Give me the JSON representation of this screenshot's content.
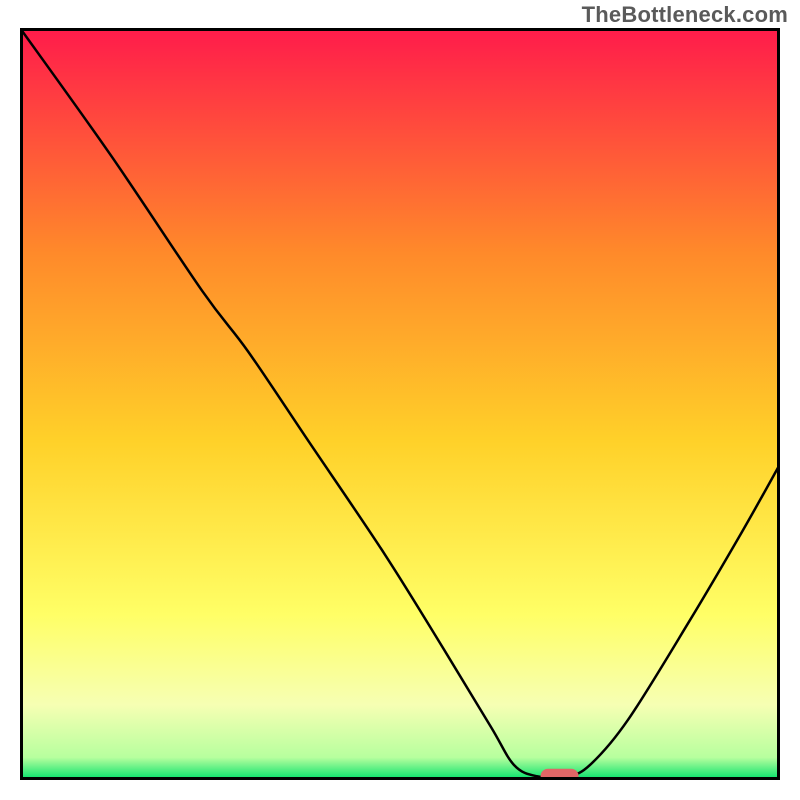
{
  "watermark": "TheBottleneck.com",
  "chart_data": {
    "type": "line",
    "title": "",
    "xlabel": "",
    "ylabel": "",
    "xlim": [
      0,
      100
    ],
    "ylim": [
      0,
      100
    ],
    "grid": false,
    "legend": false,
    "background_gradient": {
      "top_color": "#ff1b4b",
      "mid_colors": [
        "#ff8a2a",
        "#ffd129",
        "#ffff66",
        "#f6ffb3"
      ],
      "bottom_color": "#00e06a"
    },
    "series": [
      {
        "name": "bottleneck-curve",
        "stroke": "#000000",
        "stroke_width": 2.5,
        "points": [
          {
            "x": 0.0,
            "y": 100.0
          },
          {
            "x": 12.0,
            "y": 83.0
          },
          {
            "x": 24.0,
            "y": 65.0
          },
          {
            "x": 30.0,
            "y": 57.0
          },
          {
            "x": 38.0,
            "y": 45.0
          },
          {
            "x": 48.0,
            "y": 30.0
          },
          {
            "x": 56.0,
            "y": 17.0
          },
          {
            "x": 62.0,
            "y": 7.0
          },
          {
            "x": 65.0,
            "y": 2.0
          },
          {
            "x": 68.0,
            "y": 0.5
          },
          {
            "x": 72.0,
            "y": 0.5
          },
          {
            "x": 75.0,
            "y": 2.0
          },
          {
            "x": 80.0,
            "y": 8.0
          },
          {
            "x": 88.0,
            "y": 21.0
          },
          {
            "x": 95.0,
            "y": 33.0
          },
          {
            "x": 100.0,
            "y": 42.0
          }
        ]
      }
    ],
    "marker": {
      "name": "min-marker",
      "x": 71.0,
      "y": 0.5,
      "shape": "pill",
      "fill": "#e06666",
      "width_pct": 5.0,
      "height_pct": 2.0
    },
    "frame_stroke": "#000000",
    "frame_stroke_width": 3
  }
}
